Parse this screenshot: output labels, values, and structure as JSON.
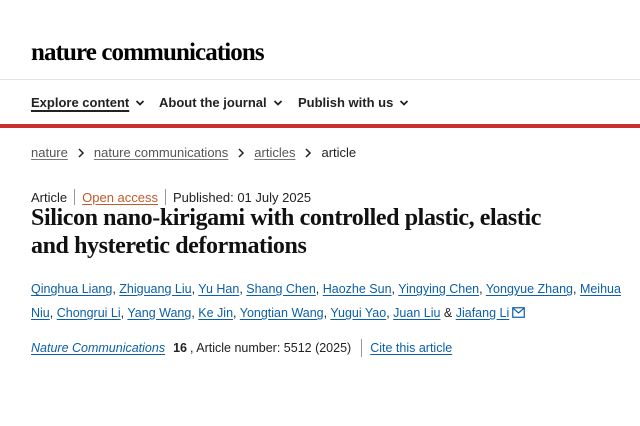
{
  "site": {
    "logo": "nature communications"
  },
  "nav": {
    "items": [
      {
        "label": "Explore content"
      },
      {
        "label": "About the journal"
      },
      {
        "label": "Publish with us"
      }
    ]
  },
  "breadcrumb": {
    "items": [
      "nature",
      "nature communications",
      "articles"
    ],
    "current": "article"
  },
  "meta": {
    "type": "Article",
    "access": "Open access",
    "published": "Published: 01 July 2025"
  },
  "article": {
    "title_line1": "Silicon nano-kirigami with controlled plastic, elastic",
    "title_line2": "and hysteretic deformations"
  },
  "authors": {
    "list": [
      "Qinghua Liang",
      "Zhiguang Liu",
      "Yu Han",
      "Shang Chen",
      "Haozhe Sun",
      "Yingying Chen",
      "Yongyue Zhang",
      "Meihua Niu",
      "Chongrui Li",
      "Yang Wang",
      "Ke Jin",
      "Yongtian Wang",
      "Yugui Yao",
      "Juan Liu",
      "Jiafang Li"
    ],
    "separator": ", ",
    "conjunction": " & "
  },
  "citation": {
    "journal": "Nature Communications",
    "volume": "16",
    "article_number": ", Article number: 5512 (2025)",
    "cite_label": "Cite this article"
  },
  "colors": {
    "accent_red": "#c9302c",
    "link_blue": "#0c5fa8",
    "open_access": "#c05b2a"
  }
}
